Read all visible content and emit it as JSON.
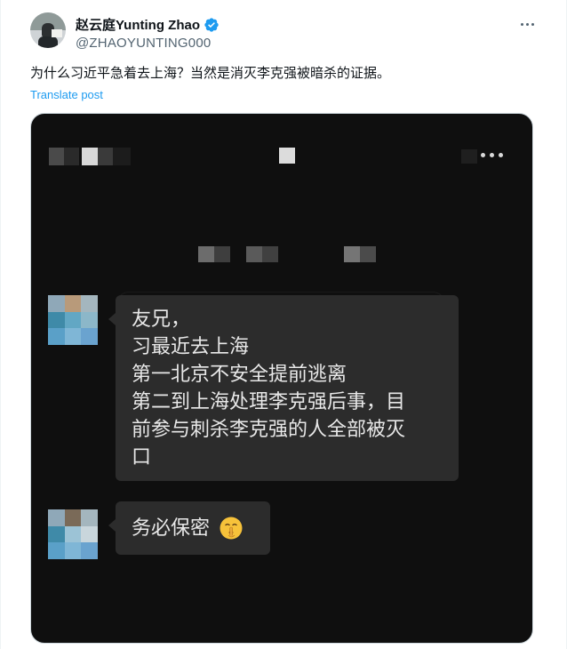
{
  "author": {
    "display_name": "赵云庭Yunting Zhao",
    "handle": "@ZHAOYUNTING000",
    "verified": true
  },
  "post": {
    "text": "为什么习近平急着去上海？当然是消灭李克强被暗杀的证据。",
    "translate_label": "Translate post"
  },
  "image": {
    "messages": [
      {
        "lines": [
          "友兄，",
          "习最近去上海",
          "第一北京不安全提前逃离",
          "第二到上海处理李克强后事，目",
          "前参与刺杀李克强的人全部被灭",
          "口"
        ]
      },
      {
        "text": "务必保密",
        "emoji": "shushing-face"
      }
    ]
  },
  "colors": {
    "accent": "#1d9bf0",
    "chat_background": "#0f0f0f",
    "bubble": "#2c2c2c"
  }
}
